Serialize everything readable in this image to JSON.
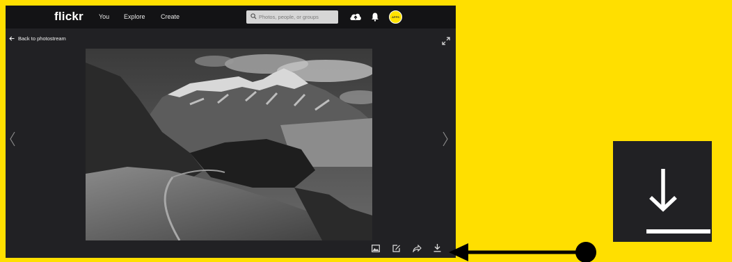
{
  "header": {
    "logo": "flickr",
    "nav": [
      "You",
      "Explore",
      "Create"
    ],
    "search_placeholder": "Photos, people, or groups",
    "icons": [
      "upload-cloud-icon",
      "notifications-bell-icon"
    ],
    "avatar_text": "APPS"
  },
  "viewer": {
    "back_label": "Back to photostream",
    "photo": "black-and-white mountain landscape",
    "action_icons": [
      "photo-icon",
      "edit-icon",
      "share-icon",
      "download-icon"
    ]
  },
  "annotation": {
    "color_background": "#FFDF00",
    "color_arrow": "#000000",
    "zoomed_icon": "download-icon"
  }
}
